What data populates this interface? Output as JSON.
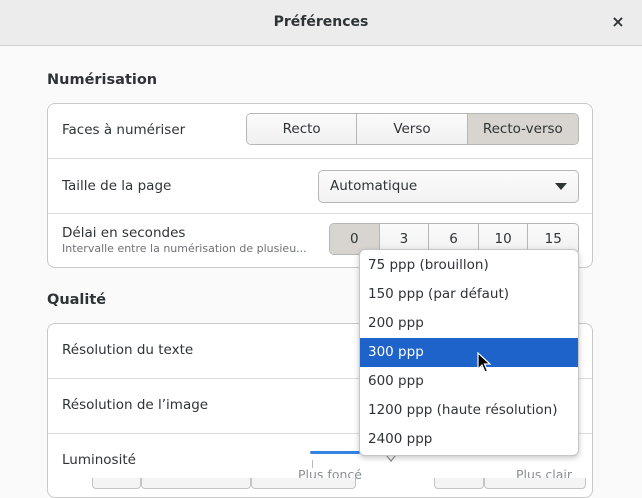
{
  "window": {
    "title": "Préférences",
    "close_icon": "×"
  },
  "scanning": {
    "section_title": "Numérisation",
    "sides": {
      "label": "Faces à numériser",
      "options": [
        "Recto",
        "Verso",
        "Recto-verso"
      ],
      "selected": "Recto-verso"
    },
    "page_size": {
      "label": "Taille de la page",
      "value": "Automatique"
    },
    "delay": {
      "label": "Délai en secondes",
      "sublabel": "Intervalle entre la numérisation de plusieu...",
      "options": [
        "0",
        "3",
        "6",
        "10",
        "15"
      ],
      "selected": "0"
    }
  },
  "quality": {
    "section_title": "Qualité",
    "text_resolution": {
      "label": "Résolution du texte"
    },
    "image_resolution": {
      "label": "Résolution de l’image"
    },
    "brightness": {
      "label": "Luminosité",
      "min_label": "Plus foncé",
      "max_label": "Plus clair"
    }
  },
  "resolution_dropdown": {
    "options": [
      "75 ppp (brouillon)",
      "150 ppp (par défaut)",
      "200 ppp",
      "300 ppp",
      "600 ppp",
      "1200 ppp (haute résolution)",
      "2400 ppp"
    ],
    "selected": "300 ppp"
  },
  "colors": {
    "accent": "#1d63c9",
    "slider": "#3584e4",
    "segment_active": "#d8d5d1"
  }
}
